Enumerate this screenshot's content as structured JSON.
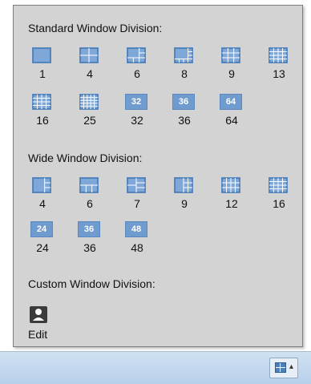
{
  "standard": {
    "title": "Standard Window Division:",
    "rows": [
      [
        {
          "label": "1",
          "kind": "g1"
        },
        {
          "label": "4",
          "kind": "g4"
        },
        {
          "label": "6",
          "kind": "g6"
        },
        {
          "label": "8",
          "kind": "g8"
        },
        {
          "label": "9",
          "kind": "g9"
        },
        {
          "label": "13",
          "kind": "g13"
        }
      ],
      [
        {
          "label": "16",
          "kind": "g16"
        },
        {
          "label": "25",
          "kind": "g25"
        },
        {
          "label": "32",
          "kind": "text",
          "text": "32"
        },
        {
          "label": "36",
          "kind": "text",
          "text": "36"
        },
        {
          "label": "64",
          "kind": "text",
          "text": "64"
        }
      ]
    ]
  },
  "wide": {
    "title": "Wide Window Division:",
    "rows": [
      [
        {
          "label": "4",
          "kind": "w4"
        },
        {
          "label": "6",
          "kind": "w6"
        },
        {
          "label": "7",
          "kind": "w7"
        },
        {
          "label": "9",
          "kind": "w9"
        },
        {
          "label": "12",
          "kind": "w12"
        },
        {
          "label": "16",
          "kind": "w16"
        }
      ],
      [
        {
          "label": "24",
          "kind": "text",
          "text": "24"
        },
        {
          "label": "36",
          "kind": "text",
          "text": "36"
        },
        {
          "label": "48",
          "kind": "text",
          "text": "48"
        }
      ]
    ]
  },
  "custom": {
    "title": "Custom Window Division:",
    "edit_label": "Edit",
    "edit_icon": "user-icon"
  },
  "taskbar": {
    "button_icon": "window-division-icon"
  },
  "colors": {
    "panel_bg": "#d3d3d3",
    "tile": "#6f9bcf",
    "taskbar": "#c4d8ee"
  }
}
